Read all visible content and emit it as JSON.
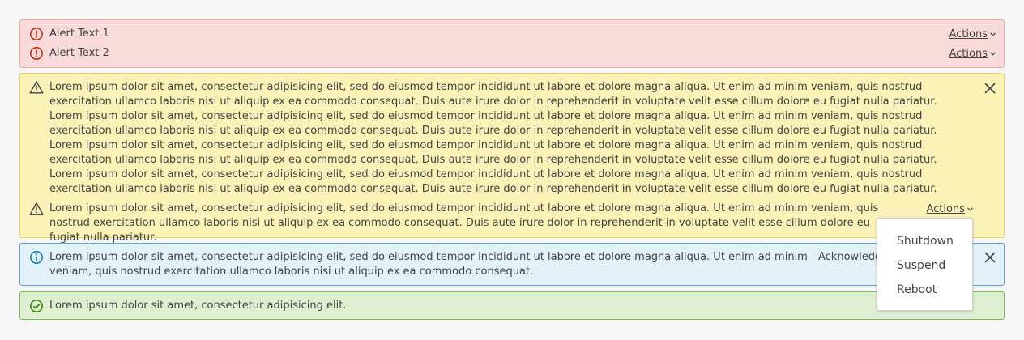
{
  "danger_alert": {
    "items": [
      {
        "text": "Alert Text 1",
        "icon": "error-circle-icon",
        "actions_label": "Actions"
      },
      {
        "text": "Alert Text 2",
        "icon": "error-circle-icon",
        "actions_label": "Actions"
      }
    ]
  },
  "warning_alert": {
    "items": [
      {
        "icon": "warning-triangle-icon",
        "text": "Lorem ipsum dolor sit amet, consectetur adipisicing elit, sed do eiusmod tempor incididunt ut labore et dolore magna aliqua. Ut enim ad minim veniam, quis nostrud exercitation ullamco laboris nisi ut aliquip ex ea commodo consequat. Duis aute irure dolor in reprehenderit in voluptate velit esse cillum dolore eu fugiat nulla pariatur. Lorem ipsum dolor sit amet, consectetur adipisicing elit, sed do eiusmod tempor incididunt ut labore et dolore magna aliqua. Ut enim ad minim veniam, quis nostrud exercitation ullamco laboris nisi ut aliquip ex ea commodo consequat. Duis aute irure dolor in reprehenderit in voluptate velit esse cillum dolore eu fugiat nulla pariatur. Lorem ipsum dolor sit amet, consectetur adipisicing elit, sed do eiusmod tempor incididunt ut labore et dolore magna aliqua. Ut enim ad minim veniam, quis nostrud exercitation ullamco laboris nisi ut aliquip ex ea commodo consequat. Duis aute irure dolor in reprehenderit in voluptate velit esse cillum dolore eu fugiat nulla pariatur. Lorem ipsum dolor sit amet, consectetur adipisicing elit, sed do eiusmod tempor incididunt ut labore et dolore magna aliqua. Ut enim ad minim veniam, quis nostrud exercitation ullamco laboris nisi ut aliquip ex ea commodo consequat. Duis aute irure dolor in reprehenderit in voluptate velit esse cillum dolore eu fugiat nulla pariatur."
      },
      {
        "icon": "warning-triangle-icon",
        "text": "Lorem ipsum dolor sit amet, consectetur adipisicing elit, sed do eiusmod tempor incididunt ut labore et dolore magna aliqua. Ut enim ad minim veniam, quis nostrud exercitation ullamco laboris nisi ut aliquip ex ea commodo consequat. Duis aute irure dolor in reprehenderit in voluptate velit esse cillum dolore eu fugiat nulla pariatur.",
        "actions_label": "Actions"
      }
    ],
    "close_icon": "close-icon"
  },
  "info_alert": {
    "icon": "info-circle-icon",
    "text": "Lorem ipsum dolor sit amet, consectetur adipisicing elit, sed do eiusmod tempor incididunt ut labore et dolore magna aliqua. Ut enim ad minim veniam, quis nostrud exercitation ullamco laboris nisi ut aliquip ex ea commodo consequat.",
    "acknowledge_label": "Acknowledge",
    "close_icon": "close-icon"
  },
  "success_alert": {
    "icon": "check-circle-icon",
    "text": "Lorem ipsum dolor sit amet, consectetur adipisicing elit."
  },
  "actions_menu": {
    "items": [
      "Shutdown",
      "Suspend",
      "Reboot"
    ]
  },
  "colors": {
    "danger_bg": "#f8dadb",
    "danger_icon": "#c92100",
    "warning_bg": "#fbf2b7",
    "info_bg": "#e3f1f9",
    "info_icon": "#0079b8",
    "success_bg": "#dff0d2",
    "success_icon": "#2f8400"
  }
}
